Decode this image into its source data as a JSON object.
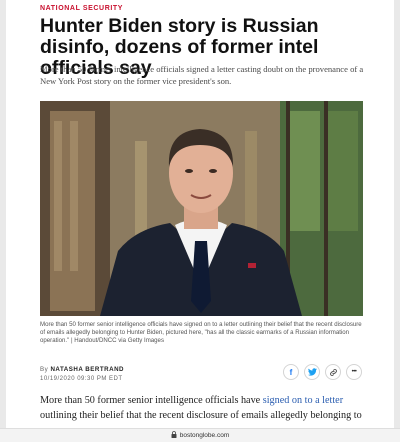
{
  "article": {
    "section_label": "NATIONAL SECURITY",
    "headline": "Hunter Biden story is Russian disinfo, dozens of former intel officials say",
    "dek": "More than 50 former intelligence officials signed a letter casting doubt on the provenance of a New York Post story on the former vice president's son.",
    "caption": "More than 50 former senior intelligence officials have signed on to a letter outlining their belief that the recent disclosure of emails allegedly belonging to Hunter Biden, pictured here, \"has all the classic earmarks of a Russian information operation.\" | Handout/DNCC via Getty Images",
    "byline_prefix": "By",
    "author": "NATASHA BERTRAND",
    "dateline": "10/19/2020 09:30 PM EDT",
    "body_before_link": "More than 50 former senior intelligence officials have ",
    "body_link": "signed on to a letter",
    "body_after_link": " outlining their belief that the recent disclosure of emails allegedly belonging to"
  },
  "share": {
    "facebook_icon": "f",
    "twitter_icon": "t",
    "link_icon": "link",
    "more_icon": "•••"
  },
  "browser": {
    "url": "bostonglobe.com"
  },
  "colors": {
    "section": "#c8102e",
    "link": "#2a5db0",
    "facebook": "#1877f2",
    "twitter": "#1da1f2"
  }
}
